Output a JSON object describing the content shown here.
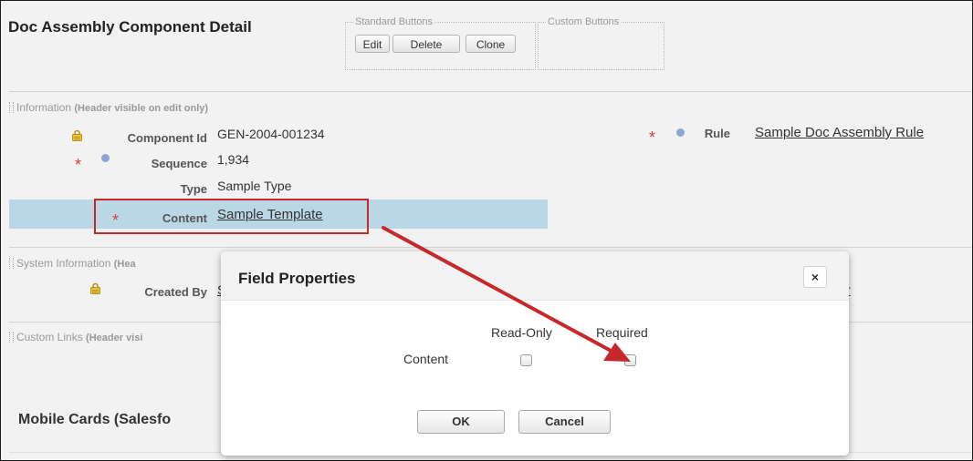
{
  "header": {
    "title": "Doc Assembly Component Detail",
    "standard_legend": "Standard Buttons",
    "custom_legend": "Custom Buttons",
    "buttons": {
      "edit": "Edit",
      "delete": "Delete",
      "clone": "Clone"
    }
  },
  "information": {
    "title": "Information",
    "note": "(Header visible on edit only)",
    "fields": {
      "component_id": {
        "label": "Component Id",
        "value": "GEN-2004-001234"
      },
      "sequence": {
        "label": "Sequence",
        "value": "1,934"
      },
      "type": {
        "label": "Type",
        "value": "Sample Type"
      },
      "content": {
        "label": "Content",
        "value": "Sample Template"
      },
      "rule": {
        "label": "Rule",
        "value": "Sample Doc Assembly Rule"
      }
    },
    "required_mark": "*"
  },
  "system_information": {
    "title": "System Information",
    "note": "(Hea",
    "created_by": {
      "label": "Created By",
      "value": "S"
    },
    "right_value": "r"
  },
  "custom_links": {
    "title": "Custom Links",
    "note": "(Header visi"
  },
  "mobile_cards": {
    "title": "Mobile Cards (Salesfo"
  },
  "modal": {
    "title": "Field Properties",
    "close": "×",
    "col_readonly": "Read-Only",
    "col_required": "Required",
    "row_label": "Content",
    "readonly_checked": false,
    "required_checked": false,
    "ok": "OK",
    "cancel": "Cancel"
  },
  "colors": {
    "highlight": "#bad7e6",
    "annotation": "#c6292c",
    "required": "#e23b3b",
    "page_bg": "#f2f2f2"
  }
}
